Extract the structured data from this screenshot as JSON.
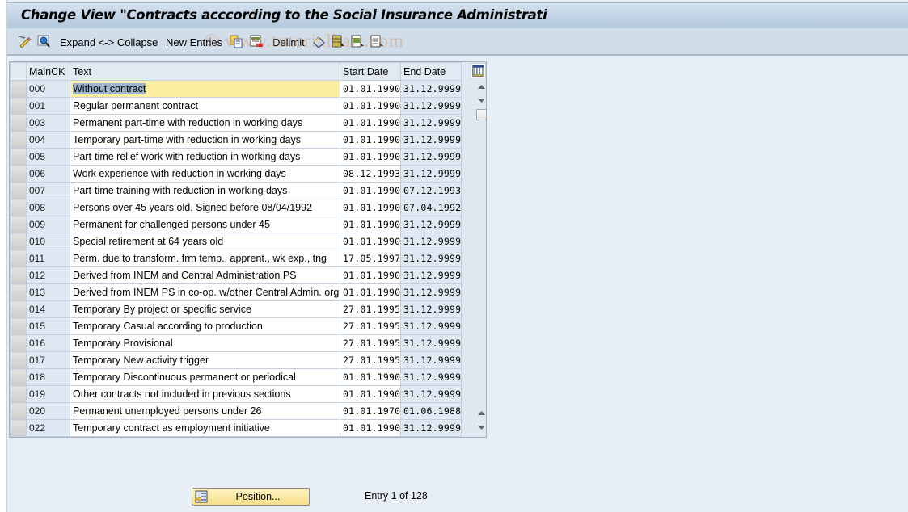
{
  "window": {
    "title": "Change View \"Contracts acccording to the Social Insurance Administrati"
  },
  "toolbar": {
    "items": [
      {
        "icon": "display-change-icon"
      },
      {
        "icon": "details-icon"
      },
      {
        "label": "Expand <-> Collapse"
      },
      {
        "label": "New Entries"
      },
      {
        "icon": "copy-as-icon"
      },
      {
        "icon": "delete-icon"
      },
      {
        "label": "Delimit"
      },
      {
        "icon": "undo-change-icon"
      },
      {
        "icon": "select-all-icon"
      },
      {
        "icon": "select-block-icon"
      },
      {
        "icon": "deselect-all-icon"
      }
    ],
    "watermark": "© www.tutorialkart.com"
  },
  "table": {
    "columns": [
      "MainCK",
      "Text",
      "Start Date",
      "End Date"
    ],
    "rows": [
      {
        "key": "000",
        "text": "Without contract",
        "start": "01.01.1990",
        "end": "31.12.9999"
      },
      {
        "key": "001",
        "text": "Regular permanent contract",
        "start": "01.01.1990",
        "end": "31.12.9999"
      },
      {
        "key": "003",
        "text": "Permanent part-time with reduction in working days",
        "start": "01.01.1990",
        "end": "31.12.9999"
      },
      {
        "key": "004",
        "text": "Temporary part-time with reduction in working days",
        "start": "01.01.1990",
        "end": "31.12.9999"
      },
      {
        "key": "005",
        "text": "Part-time relief work with reduction in working days",
        "start": "01.01.1990",
        "end": "31.12.9999"
      },
      {
        "key": "006",
        "text": "Work experience with reduction in working days",
        "start": "08.12.1993",
        "end": "31.12.9999"
      },
      {
        "key": "007",
        "text": "Part-time training with reduction in working days",
        "start": "01.01.1990",
        "end": "07.12.1993"
      },
      {
        "key": "008",
        "text": "Persons over 45 years old. Signed before 08/04/1992",
        "start": "01.01.1990",
        "end": "07.04.1992"
      },
      {
        "key": "009",
        "text": "Permanent for challenged persons under 45",
        "start": "01.01.1990",
        "end": "31.12.9999"
      },
      {
        "key": "010",
        "text": "Special retirement at 64 years old",
        "start": "01.01.1990",
        "end": "31.12.9999"
      },
      {
        "key": "011",
        "text": "Perm. due to transform. frm temp., apprent., wk exp., tng",
        "start": "17.05.1997",
        "end": "31.12.9999"
      },
      {
        "key": "012",
        "text": "Derived from INEM and Central Administration PS",
        "start": "01.01.1990",
        "end": "31.12.9999"
      },
      {
        "key": "013",
        "text": "Derived from INEM PS in co-op. w/other Central Admin. org.",
        "start": "01.01.1990",
        "end": "31.12.9999"
      },
      {
        "key": "014",
        "text": "Temporary By project or specific service",
        "start": "27.01.1995",
        "end": "31.12.9999"
      },
      {
        "key": "015",
        "text": "Temporary Casual according to production",
        "start": "27.01.1995",
        "end": "31.12.9999"
      },
      {
        "key": "016",
        "text": "Temporary Provisional",
        "start": "27.01.1995",
        "end": "31.12.9999"
      },
      {
        "key": "017",
        "text": "Temporary New activity trigger",
        "start": "27.01.1995",
        "end": "31.12.9999"
      },
      {
        "key": "018",
        "text": "Temporary Discontinuous permanent or periodical",
        "start": "01.01.1990",
        "end": "31.12.9999"
      },
      {
        "key": "019",
        "text": "Other contracts not included in previous sections",
        "start": "01.01.1990",
        "end": "31.12.9999"
      },
      {
        "key": "020",
        "text": "Permanent unemployed persons under 26",
        "start": "01.01.1970",
        "end": "01.06.1988"
      },
      {
        "key": "022",
        "text": "Temporary contract as employment initiative",
        "start": "01.01.1990",
        "end": "31.12.9999"
      }
    ]
  },
  "footer": {
    "position_label": "Position...",
    "entry_info": "Entry 1 of 128"
  },
  "colors": {
    "focus_cell": "#fbee9f",
    "position_button": "#f6de86",
    "title_bar": "#b3c8dd"
  }
}
